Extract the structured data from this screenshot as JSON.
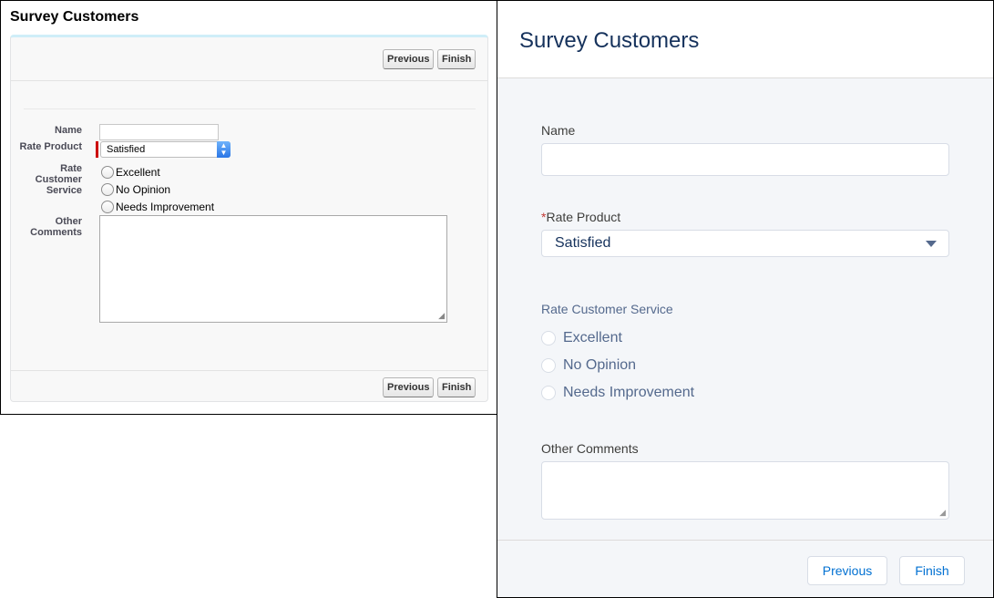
{
  "classic": {
    "title": "Survey Customers",
    "buttons": {
      "previous": "Previous",
      "finish": "Finish"
    },
    "fields": {
      "name_label": "Name",
      "rate_product_label": "Rate Product",
      "rate_product_value": "Satisfied",
      "rate_service_label": "Rate Customer Service",
      "options": [
        "Excellent",
        "No Opinion",
        "Needs Improvement"
      ],
      "comments_label": "Other Comments"
    }
  },
  "lightning": {
    "title": "Survey Customers",
    "fields": {
      "name_label": "Name",
      "required_marker": "*",
      "rate_product_label": "Rate Product",
      "rate_product_value": "Satisfied",
      "rate_service_label": "Rate Customer Service",
      "options": [
        "Excellent",
        "No Opinion",
        "Needs Improvement"
      ],
      "comments_label": "Other Comments"
    },
    "buttons": {
      "previous": "Previous",
      "finish": "Finish"
    },
    "colors": {
      "title": "#16325c",
      "button_text": "#0070d2",
      "required": "#c23934"
    }
  }
}
